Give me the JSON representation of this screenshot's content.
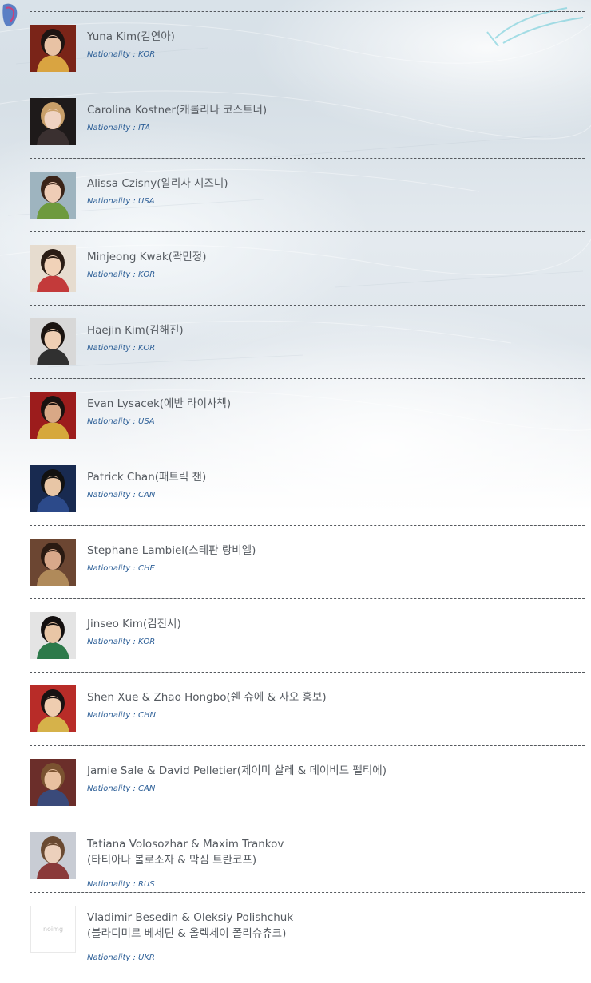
{
  "nationality_label": "Nationality",
  "noimg_label": "noimg",
  "skaters": [
    {
      "name": "Yuna Kim(김연아)",
      "nationality": "KOR",
      "photo": {
        "bg": "#7a2418",
        "skin": "#e8c2a4",
        "hair": "#1d1412",
        "accent": "#d9a441"
      }
    },
    {
      "name": "Carolina Kostner(캐롤리나 코스트너)",
      "nationality": "ITA",
      "photo": {
        "bg": "#1e1a1a",
        "skin": "#efd3c2",
        "hair": "#c9a06a",
        "accent": "#3a3030"
      }
    },
    {
      "name": "Alissa Czisny(알리사 시즈니)",
      "nationality": "USA",
      "photo": {
        "bg": "#9eb4bf",
        "skin": "#efcdb6",
        "hair": "#3a2418",
        "accent": "#6e9a3e"
      }
    },
    {
      "name": "Minjeong Kwak(곽민정)",
      "nationality": "KOR",
      "photo": {
        "bg": "#e6dccf",
        "skin": "#f1d2b8",
        "hair": "#2a1c14",
        "accent": "#c33a3a"
      }
    },
    {
      "name": "Haejin Kim(김해진)",
      "nationality": "KOR",
      "photo": {
        "bg": "#d8d8d8",
        "skin": "#efcfb4",
        "hair": "#1b1411",
        "accent": "#303030"
      }
    },
    {
      "name": "Evan Lysacek(에반 라이사첵)",
      "nationality": "USA",
      "photo": {
        "bg": "#9c1c1c",
        "skin": "#d9a886",
        "hair": "#1b1210",
        "accent": "#d6a83c"
      }
    },
    {
      "name": "Patrick Chan(패트릭 챈)",
      "nationality": "CAN",
      "photo": {
        "bg": "#182a50",
        "skin": "#e8c6a6",
        "hair": "#111111",
        "accent": "#2c4a8a"
      }
    },
    {
      "name": "Stephane Lambiel(스테판 랑비엘)",
      "nationality": "CHE",
      "photo": {
        "bg": "#6c4632",
        "skin": "#d8a88a",
        "hair": "#2a1a12",
        "accent": "#b08a5a"
      }
    },
    {
      "name": "Jinseo Kim(김진서)",
      "nationality": "KOR",
      "photo": {
        "bg": "#e4e4e4",
        "skin": "#e9c6a6",
        "hair": "#141010",
        "accent": "#2d7a4a"
      }
    },
    {
      "name": "Shen Xue & Zhao Hongbo(쉔 슈에 & 자오 홍보)",
      "nationality": "CHN",
      "photo": {
        "bg": "#b82c28",
        "skin": "#efcdb0",
        "hair": "#181212",
        "accent": "#d6b24a"
      }
    },
    {
      "name": "Jamie Sale & David Pelletier(제이미 살레 & 데이비드 펠티에)",
      "nationality": "CAN",
      "photo": {
        "bg": "#6b2e2a",
        "skin": "#e8c0a0",
        "hair": "#7a5230",
        "accent": "#3a4a7a"
      }
    },
    {
      "name_lines": [
        "Tatiana Volosozhar & Maxim Trankov",
        "(타티아나 볼로소자 & 막심 트란코프)"
      ],
      "nationality": "RUS",
      "photo": {
        "bg": "#c8ccd4",
        "skin": "#ecd0bc",
        "hair": "#6a4a32",
        "accent": "#8a3a3a"
      }
    },
    {
      "name_lines": [
        "Vladimir Besedin & Oleksiy Polishchuk",
        "(블라디미르 베세딘 & 올렉세이 폴리슈츄크)"
      ],
      "nationality": "UKR",
      "photo": null
    }
  ]
}
